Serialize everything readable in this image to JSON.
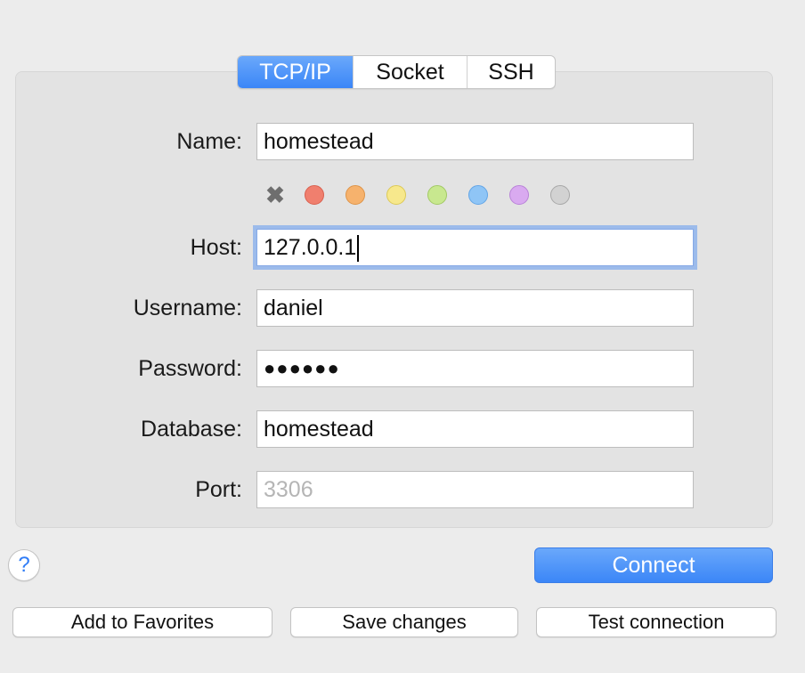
{
  "tabs": [
    {
      "label": "TCP/IP",
      "active": true
    },
    {
      "label": "Socket",
      "active": false
    },
    {
      "label": "SSH",
      "active": false
    }
  ],
  "form": {
    "name_label": "Name:",
    "name_value": "homestead",
    "host_label": "Host:",
    "host_value": "127.0.0.1",
    "username_label": "Username:",
    "username_value": "daniel",
    "password_label": "Password:",
    "password_value": "●●●●●●",
    "database_label": "Database:",
    "database_value": "homestead",
    "port_label": "Port:",
    "port_placeholder": "3306"
  },
  "color_tags": {
    "clear_icon": "✖",
    "colors": [
      {
        "name": "red",
        "fill": "#f07f6e",
        "border": "#d9604f"
      },
      {
        "name": "orange",
        "fill": "#f6b26d",
        "border": "#de9448"
      },
      {
        "name": "yellow",
        "fill": "#f7e88c",
        "border": "#dcc956"
      },
      {
        "name": "green",
        "fill": "#c8e88f",
        "border": "#a2c965"
      },
      {
        "name": "blue",
        "fill": "#8fc5f6",
        "border": "#62a5e6"
      },
      {
        "name": "purple",
        "fill": "#d9aaf0",
        "border": "#b982d8"
      },
      {
        "name": "gray",
        "fill": "#d2d2d2",
        "border": "#a8a8a8"
      }
    ]
  },
  "actions": {
    "help_label": "?",
    "connect_label": "Connect",
    "add_favorites_label": "Add to Favorites",
    "save_changes_label": "Save changes",
    "test_connection_label": "Test connection"
  }
}
